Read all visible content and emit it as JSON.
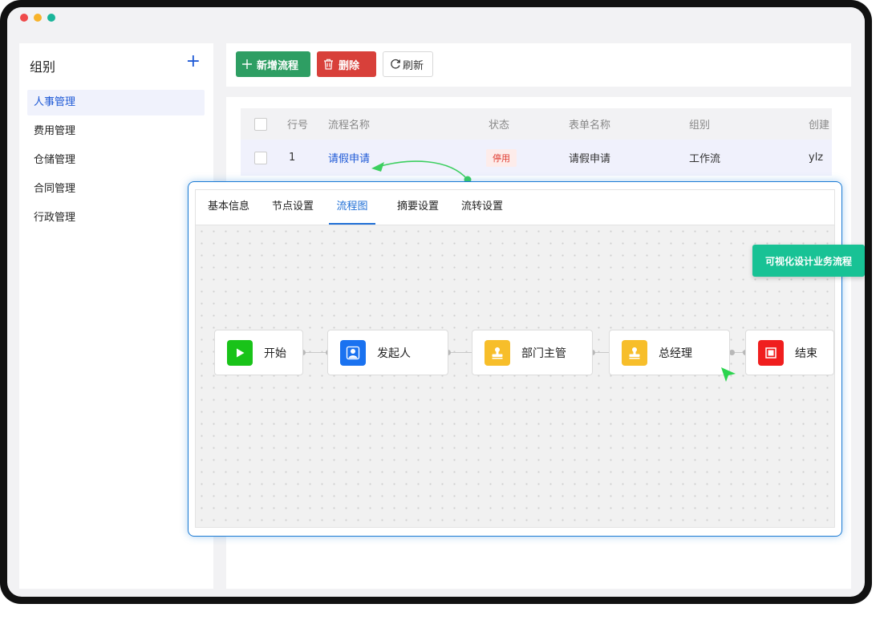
{
  "window": {
    "dots": [
      "#ef4a4a",
      "#f7b32b",
      "#1ab59a"
    ]
  },
  "sidebar": {
    "title": "组别",
    "add_glyph": "+",
    "items": [
      {
        "label": "人事管理",
        "active": true
      },
      {
        "label": "费用管理"
      },
      {
        "label": "仓储管理"
      },
      {
        "label": "合同管理"
      },
      {
        "label": "行政管理"
      }
    ]
  },
  "toolbar": {
    "add_label": "新增流程",
    "delete_label": "删除",
    "refresh_label": "刷新",
    "colors": {
      "add": "#2e9e63",
      "delete": "#d8403a"
    }
  },
  "table": {
    "columns": [
      "行号",
      "流程名称",
      "状态",
      "表单名称",
      "组别",
      "创建"
    ],
    "rows": [
      {
        "no": "1",
        "name": "请假申请",
        "status": "停用",
        "form": "请假申请",
        "group": "工作流",
        "creator": "ylz"
      }
    ]
  },
  "dialog": {
    "tabs": [
      "基本信息",
      "节点设置",
      "流程图",
      "摘要设置",
      "流转设置"
    ],
    "active_tab": "流程图",
    "nodes": [
      {
        "label": "开始",
        "icon": "play-icon",
        "color": "#19c319"
      },
      {
        "label": "发起人",
        "icon": "user-icon",
        "color": "#1a72f0"
      },
      {
        "label": "部门主管",
        "icon": "approver-icon",
        "color": "#f7be2a"
      },
      {
        "label": "总经理",
        "icon": "approver-icon",
        "color": "#f7be2a"
      },
      {
        "label": "结束",
        "icon": "stop-icon",
        "color": "#f01e1e"
      }
    ]
  },
  "badge": {
    "label": "可视化设计业务流程",
    "color": "#18c295"
  },
  "accent": "#1f5ad6"
}
